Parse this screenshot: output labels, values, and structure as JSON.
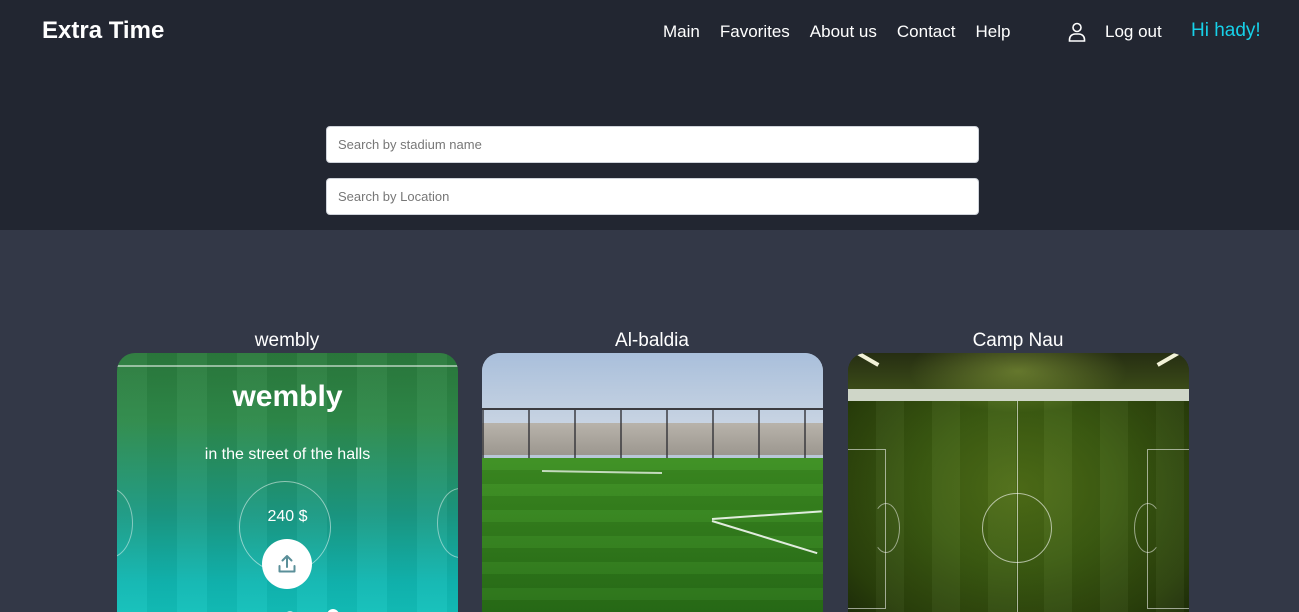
{
  "header": {
    "brand": "Extra Time",
    "nav": [
      "Main",
      "Favorites",
      "About us",
      "Contact",
      "Help"
    ],
    "logout_label": "Log out",
    "greeting": "Hi hady!",
    "greeting_color": "#17d0e8"
  },
  "search": {
    "stadium_placeholder": "Search by stadium name",
    "location_placeholder": "Search by Location",
    "stadium_value": "",
    "location_value": ""
  },
  "stadiums": [
    {
      "title": "wembly",
      "overlay_name": "wembly",
      "address": "in the street of the halls",
      "price": "240 $",
      "action_icon": "share-upload-icon"
    },
    {
      "title": "Al-baldia"
    },
    {
      "title": "Camp Nau"
    }
  ]
}
